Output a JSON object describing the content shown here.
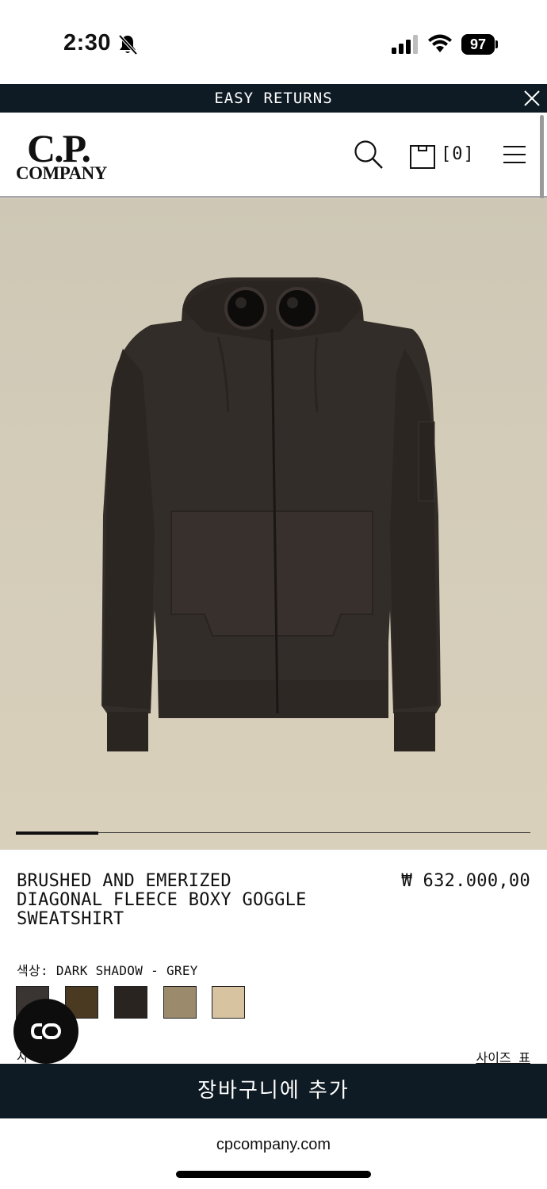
{
  "status_bar": {
    "time": "2:30",
    "battery": "97",
    "icons": [
      "bell-slash-icon",
      "cellular-signal-icon",
      "wifi-icon",
      "battery-icon"
    ]
  },
  "promo": {
    "text": "EASY RETURNS",
    "close_icon": "close-icon"
  },
  "header": {
    "logo_line1": "C.P.",
    "logo_line2": "COMPANY",
    "search_icon": "search-icon",
    "bag_icon": "shopping-bag-icon",
    "bag_count": "[0]",
    "menu_icon": "hamburger-menu-icon"
  },
  "gallery": {
    "progress": 0.16,
    "background_color": "#d3ccb9",
    "garment_color": "#332d29"
  },
  "product": {
    "title": "BRUSHED AND EMERIZED\nDIAGONAL FLEECE BOXY GOGGLE\nSWEATSHIRT",
    "price": "₩ 632.000,00",
    "color_label": "색상: DARK SHADOW - GREY",
    "swatches": [
      {
        "color": "#3a3532"
      },
      {
        "color": "#4b3a22"
      },
      {
        "color": "#2a2420"
      },
      {
        "color": "#9c8a6d"
      },
      {
        "color": "#d7c3a0"
      }
    ],
    "size_label_partial": "사",
    "size_chart_link": "사이즈 표"
  },
  "chat": {
    "icon": "chat-widget-icon",
    "label": "CO"
  },
  "cta": {
    "add_to_cart": "장바구니에 추가"
  },
  "browser": {
    "url": "cpcompany.com"
  },
  "colors": {
    "dark_navy": "#0f1b24",
    "white": "#ffffff"
  }
}
